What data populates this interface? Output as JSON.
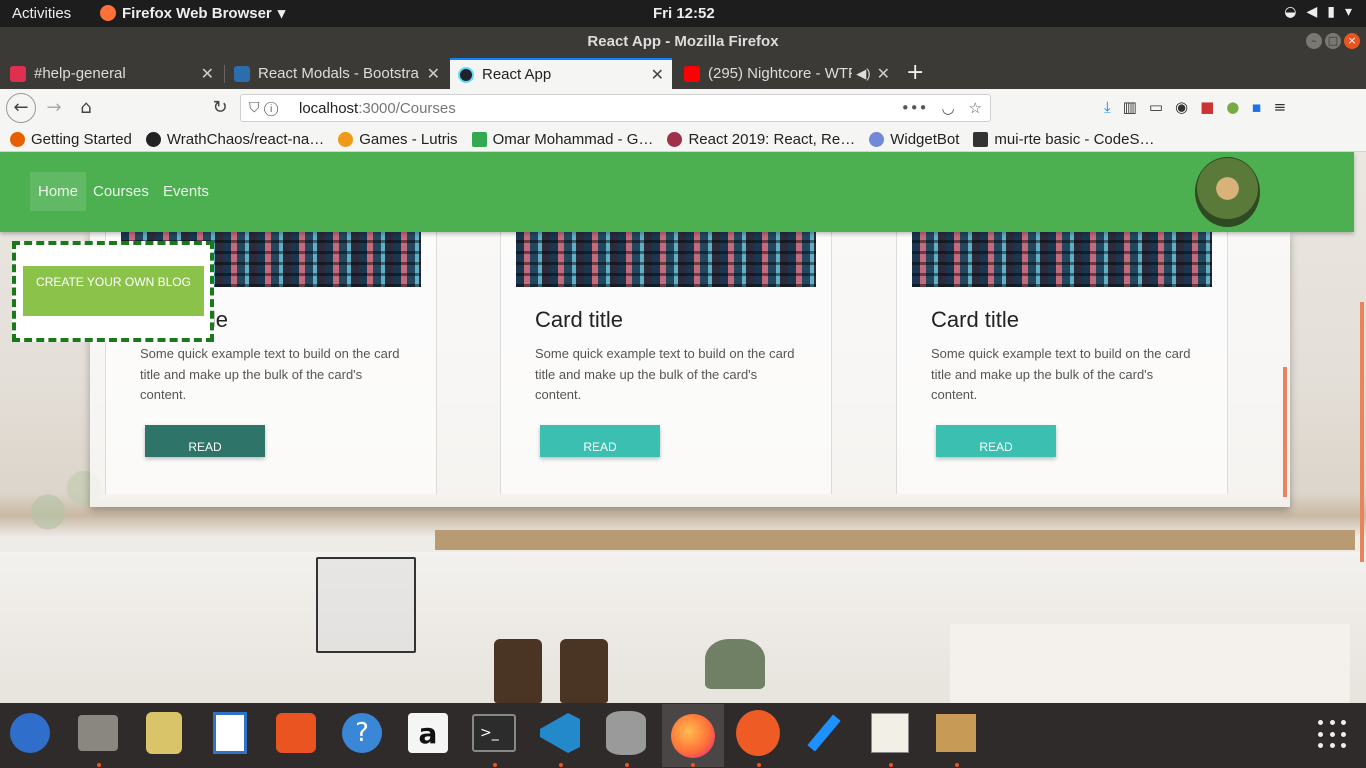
{
  "system": {
    "activities": "Activities",
    "app_menu": "Firefox Web Browser",
    "clock": "Fri 12:52"
  },
  "window": {
    "title": "React App - Mozilla Firefox"
  },
  "tabs": [
    {
      "label": "#help-general",
      "icon_color": "#e03050"
    },
    {
      "label": "React Modals - Bootstra",
      "icon_color": "#2b6dad"
    },
    {
      "label": "React App",
      "icon_color": "#61dafb"
    },
    {
      "label": "(295) Nightcore - WTF",
      "icon_color": "#ff0000"
    }
  ],
  "url": {
    "host": "localhost",
    "rest": ":3000/Courses"
  },
  "bookmarks": [
    {
      "label": "Getting Started",
      "icon_color": "#e66000"
    },
    {
      "label": "WrathChaos/react-na…",
      "icon_color": "#222222"
    },
    {
      "label": "Games - Lutris",
      "icon_color": "#f09a1a"
    },
    {
      "label": "Omar Mohammad - G…",
      "icon_color": "#34a853"
    },
    {
      "label": "React 2019: React, Re…",
      "icon_color": "#a0304a"
    },
    {
      "label": "WidgetBot",
      "icon_color": "#7289da"
    },
    {
      "label": "mui-rte basic - CodeS…",
      "icon_color": "#333333"
    }
  ],
  "app": {
    "nav": {
      "home": "Home",
      "courses": "Courses",
      "events": "Events"
    },
    "create_button": "CREATE YOUR OWN BLOG",
    "cards": [
      {
        "title": "Card title",
        "text": "Some quick example text to build on the card title and make up the bulk of the card's content.",
        "button": "READ"
      },
      {
        "title": "Card title",
        "text": "Some quick example text to build on the card title and make up the bulk of the card's content.",
        "button": "READ"
      },
      {
        "title": "Card title",
        "text": "Some quick example text to build on the card title and make up the bulk of the card's content.",
        "button": "READ"
      }
    ]
  },
  "dock_apps": [
    {
      "name": "thunderbird",
      "color": "#2f6ecb"
    },
    {
      "name": "files",
      "color": "#8a8680"
    },
    {
      "name": "rhythmbox",
      "color": "#e6c24a"
    },
    {
      "name": "writer",
      "color": "#2e73c6"
    },
    {
      "name": "software",
      "color": "#e95420"
    },
    {
      "name": "help",
      "color": "#3a87d8"
    },
    {
      "name": "amazon",
      "color": "#f5f5f5"
    },
    {
      "name": "terminal",
      "color": "#2c2c2c"
    },
    {
      "name": "vscode",
      "color": "#2489ca"
    },
    {
      "name": "database",
      "color": "#9a9a9a"
    },
    {
      "name": "firefox",
      "color": "#ff7139"
    },
    {
      "name": "postman",
      "color": "#ef5b25"
    },
    {
      "name": "color-picker",
      "color": "#1e90ff"
    },
    {
      "name": "text-editor",
      "color": "#f2efe6"
    },
    {
      "name": "archive",
      "color": "#c79a55"
    }
  ]
}
